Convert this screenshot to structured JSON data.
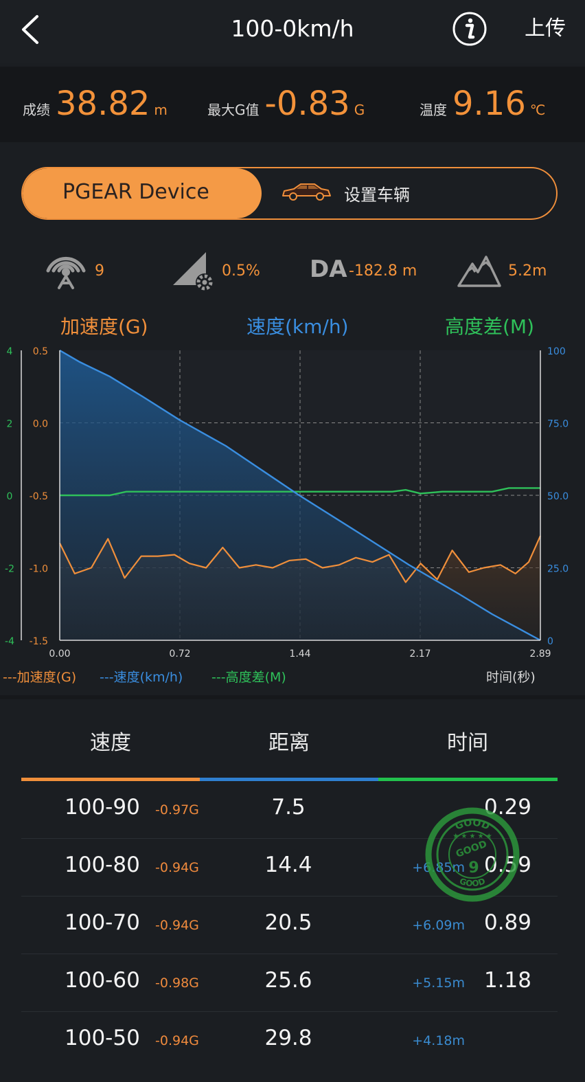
{
  "header": {
    "title": "100-0km/h",
    "upload_label": "上传"
  },
  "stats": {
    "result": {
      "label": "成绩",
      "value": "38.82",
      "unit": "m"
    },
    "max_g": {
      "label": "最大G值",
      "value": "-0.83",
      "unit": "G"
    },
    "temp": {
      "label": "温度",
      "value": "9.16",
      "unit": "℃"
    }
  },
  "device": {
    "active_label": "PGEAR Device",
    "vehicle_label": "设置车辆"
  },
  "metrics": {
    "satellites": "9",
    "slope": "0.5%",
    "da_label": "DA",
    "da_value": "-182.8 m",
    "altitude": "5.2m"
  },
  "colors": {
    "accel": "#f08f3b",
    "speed": "#3a8ee0",
    "height": "#2fc15a",
    "background": "#1b1e22"
  },
  "chart_data": {
    "type": "line",
    "axis_titles": {
      "left": "加速度(G)",
      "center": "速度(km/h)",
      "right": "高度差(M)"
    },
    "xlabel": "时间(秒)",
    "x_ticks": [
      "0.00",
      "0.72",
      "1.44",
      "2.17",
      "2.89"
    ],
    "xlim": [
      0,
      2.89
    ],
    "y_accel_ticks": [
      "0.5",
      "0.0",
      "-0.5",
      "-1.0",
      "-1.5"
    ],
    "y_accel_lim": [
      -1.5,
      0.5
    ],
    "y_height_ticks": [
      "4",
      "2",
      "0",
      "-2",
      "-4"
    ],
    "y_height_lim": [
      -4,
      4
    ],
    "y_speed_ticks": [
      "100",
      "75.0",
      "50.0",
      "25.0",
      "0"
    ],
    "y_speed_lim": [
      0,
      100
    ],
    "grid": true,
    "legend": {
      "position": "bottom-left",
      "accel": "---加速度(G)",
      "speed": "---速度(km/h)",
      "height": "---高度差(M)"
    },
    "series": [
      {
        "name": "速度(km/h)",
        "color": "#3a8ee0",
        "x": [
          0,
          0.12,
          0.3,
          0.5,
          0.72,
          1.0,
          1.44,
          1.8,
          2.1,
          2.4,
          2.6,
          2.89
        ],
        "y": [
          100,
          96,
          91,
          84,
          76,
          67,
          50,
          37,
          26,
          16,
          9,
          0
        ]
      },
      {
        "name": "加速度(G)",
        "color": "#f08f3b",
        "x": [
          0,
          0.09,
          0.19,
          0.29,
          0.39,
          0.49,
          0.59,
          0.69,
          0.78,
          0.88,
          0.98,
          1.08,
          1.18,
          1.28,
          1.38,
          1.48,
          1.58,
          1.68,
          1.78,
          1.88,
          1.98,
          2.08,
          2.17,
          2.27,
          2.36,
          2.46,
          2.55,
          2.65,
          2.74,
          2.82,
          2.89
        ],
        "y": [
          -0.83,
          -1.04,
          -1.0,
          -0.8,
          -1.07,
          -0.92,
          -0.92,
          -0.91,
          -0.97,
          -1.0,
          -0.86,
          -1.0,
          -0.98,
          -1.0,
          -0.95,
          -0.94,
          -1.0,
          -0.98,
          -0.93,
          -0.96,
          -0.91,
          -1.1,
          -0.97,
          -1.08,
          -0.88,
          -1.03,
          -1.0,
          -0.98,
          -1.04,
          -0.96,
          -0.78
        ]
      },
      {
        "name": "高度差(M)",
        "color": "#2fc15a",
        "x": [
          0,
          0.3,
          0.4,
          0.72,
          1.0,
          1.44,
          1.8,
          2.0,
          2.08,
          2.17,
          2.3,
          2.6,
          2.7,
          2.89
        ],
        "y": [
          0,
          0,
          0.1,
          0.1,
          0.1,
          0.1,
          0.1,
          0.1,
          0.15,
          0.05,
          0.1,
          0.1,
          0.2,
          0.2
        ]
      }
    ]
  },
  "table": {
    "headers": [
      "速度",
      "距离",
      "时间"
    ],
    "rows": [
      {
        "range": "100-90",
        "g": "-0.97G",
        "distance": "7.5",
        "delta": "",
        "time": "0.29"
      },
      {
        "range": "100-80",
        "g": "-0.94G",
        "distance": "14.4",
        "delta": "+6.85m",
        "time": "0.59"
      },
      {
        "range": "100-70",
        "g": "-0.94G",
        "distance": "20.5",
        "delta": "+6.09m",
        "time": "0.89"
      },
      {
        "range": "100-60",
        "g": "-0.98G",
        "distance": "25.6",
        "delta": "+5.15m",
        "time": "1.18"
      },
      {
        "range": "100-50",
        "g": "-0.94G",
        "distance": "29.8",
        "delta": "+4.18m",
        "time": ""
      }
    ]
  },
  "stamp": {
    "text_top": "GOOD",
    "text_mid": "GOOD",
    "number": "9"
  }
}
